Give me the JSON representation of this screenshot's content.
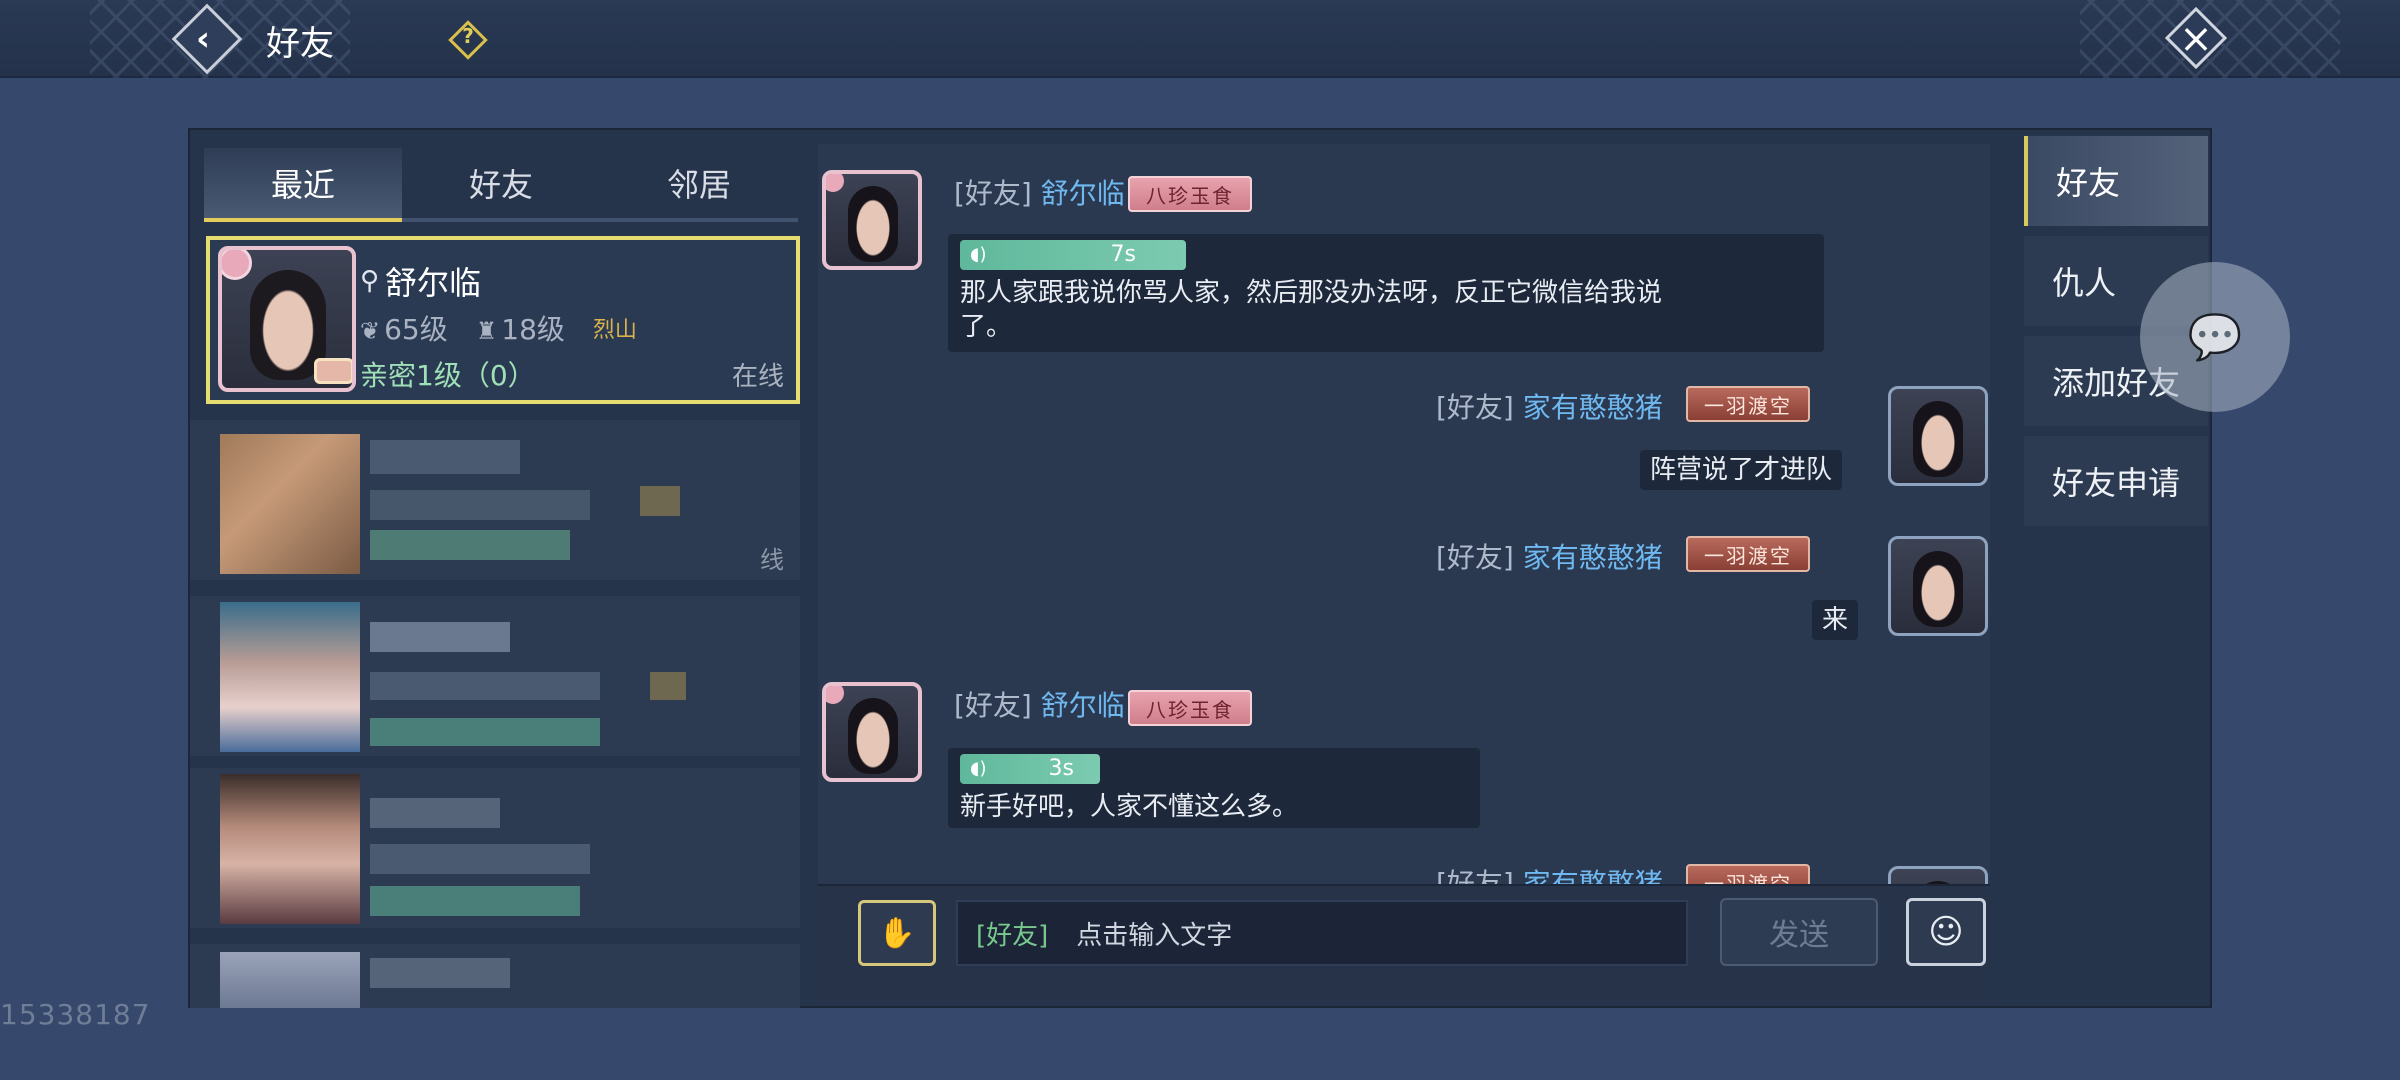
{
  "header": {
    "title": "好友",
    "back_icon": "back-arrow-icon",
    "help_icon": "question-icon",
    "close_icon": "close-x-icon"
  },
  "tabs": [
    {
      "label": "最近",
      "active": true
    },
    {
      "label": "好友",
      "active": false
    },
    {
      "label": "邻居",
      "active": false
    }
  ],
  "active_contact": {
    "name": "舒尔临",
    "level": "65级",
    "rank": "18级",
    "school": "烈山",
    "intimacy": "亲密1级（0）",
    "status": "在线"
  },
  "blurred_contact_tail": "线",
  "uid_text": "15338187",
  "chat": {
    "messages": [
      {
        "channel": "[好友]",
        "sender": "舒尔临",
        "badge": "八珍玉食",
        "voice_duration": "7s",
        "text": "那人家跟我说你骂人家，然后那没办法呀，反正它微信给我说了。"
      },
      {
        "channel": "[好友]",
        "sender": "家有憨憨猪",
        "badge": "一羽渡空",
        "text": "阵营说了才进队"
      },
      {
        "channel": "[好友]",
        "sender": "家有憨憨猪",
        "badge": "一羽渡空",
        "text": "来"
      },
      {
        "channel": "[好友]",
        "sender": "舒尔临",
        "badge": "八珍玉食",
        "voice_duration": "3s",
        "text": "新手好吧，人家不懂这么多。"
      },
      {
        "channel": "[好友]",
        "sender": "家有憨憨猪",
        "badge": "一羽渡空"
      }
    ]
  },
  "input": {
    "channel": "[好友]",
    "placeholder": "点击输入文字",
    "send_label": "发送"
  },
  "side_menu": [
    {
      "label": "好友",
      "active": true
    },
    {
      "label": "仇人",
      "active": false
    },
    {
      "label": "添加好友",
      "active": false
    },
    {
      "label": "好友申请",
      "active": false
    }
  ],
  "colors": {
    "background": "#36496c",
    "panel": "#26344b",
    "accent_yellow": "#e5dc72",
    "name_blue": "#6fb8f0",
    "voice_green": "#5fb89b",
    "intimacy_green": "#9fe0b6"
  }
}
